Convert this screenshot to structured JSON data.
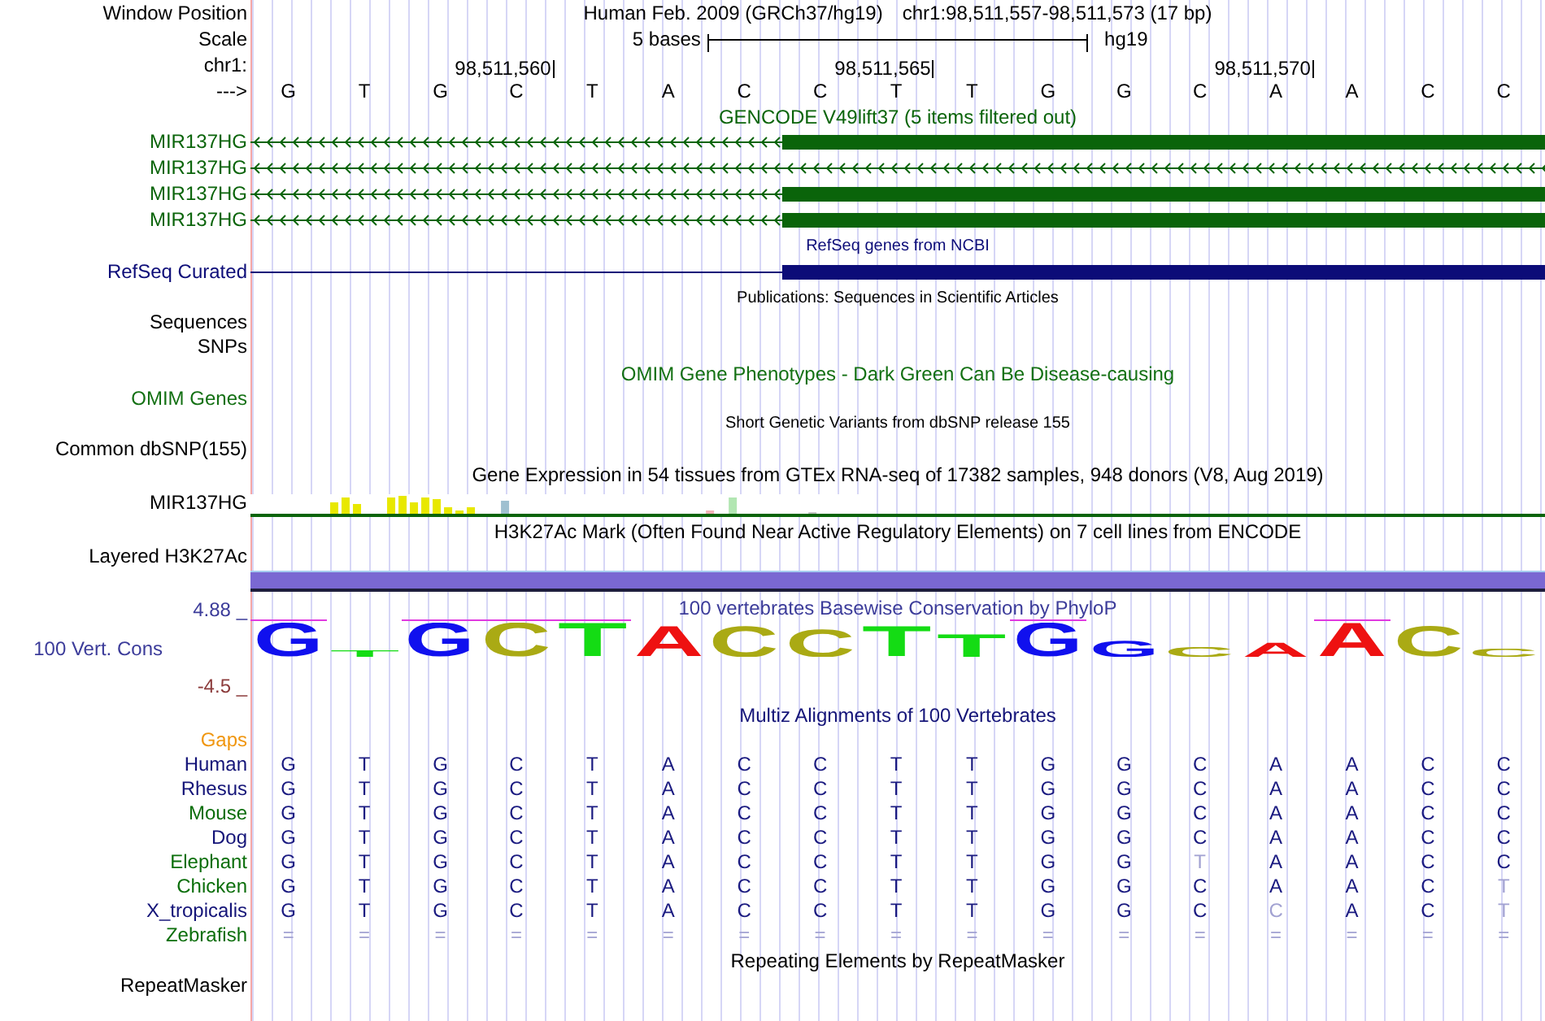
{
  "position_bar": {
    "label": "Window Position",
    "assembly": "Human Feb. 2009 (GRCh37/hg19)",
    "range": "chr1:98,511,557-98,511,573 (17 bp)"
  },
  "scale": {
    "label": "Scale",
    "length": "5 bases",
    "assembly": "hg19"
  },
  "ruler": {
    "label": "chr1:",
    "strand_label": "--->",
    "positions": [
      {
        "base": "G"
      },
      {
        "base": "T"
      },
      {
        "base": "G"
      },
      {
        "base": "C",
        "coordinate": "98,511,560"
      },
      {
        "base": "T"
      },
      {
        "base": "A"
      },
      {
        "base": "C"
      },
      {
        "base": "C"
      },
      {
        "base": "T",
        "coordinate": "98,511,565"
      },
      {
        "base": "T"
      },
      {
        "base": "G"
      },
      {
        "base": "G"
      },
      {
        "base": "C"
      },
      {
        "base": "A",
        "coordinate": "98,511,570"
      },
      {
        "base": "A"
      },
      {
        "base": "C"
      },
      {
        "base": "C"
      }
    ]
  },
  "tracks": [
    {
      "kind": "gencode",
      "title": "GENCODE V49lift37 (5 items filtered out)",
      "color": "#0a640a",
      "arrows": true,
      "items": [
        {
          "label": "MIR137HG",
          "thick": true
        },
        {
          "label": "MIR137HG",
          "thick": false
        },
        {
          "label": "MIR137HG",
          "thick": true
        },
        {
          "label": "MIR137HG",
          "thick": true
        }
      ]
    },
    {
      "kind": "refseq",
      "title": "RefSeq genes from NCBI",
      "color": "#0c0c78",
      "arrows": false,
      "items": [
        {
          "label": "RefSeq Curated",
          "thick": true
        }
      ]
    },
    {
      "kind": "publications",
      "title": "Publications: Sequences in Scientific Articles",
      "color": "#000000",
      "rows": [
        "Sequences",
        "SNPs"
      ]
    },
    {
      "kind": "omim",
      "title": "OMIM Gene Phenotypes - Dark Green Can Be Disease-causing",
      "color": "#137013",
      "rows": [
        "OMIM Genes"
      ]
    },
    {
      "kind": "dbsnp",
      "title": "Short Genetic Variants from dbSNP release 155",
      "color": "#000000",
      "rows": [
        "Common dbSNP(155)"
      ]
    },
    {
      "kind": "gtex",
      "title": "Gene Expression in 54 tissues from GTEx RNA-seq of 17382 samples, 948 donors (V8, Aug 2019)",
      "color": "#000000",
      "rows": [
        "MIR137HG"
      ]
    },
    {
      "kind": "layered",
      "title": "H3K27Ac Mark (Often Found Near Active Regulatory Elements) on 7 cell lines from ENCODE",
      "color": "#000000",
      "rows": [
        "Layered H3K27Ac"
      ]
    },
    {
      "kind": "phylop",
      "title": "100 vertebrates Basewise Conservation by PhyloP",
      "color": "#3c3c9a",
      "label": "100 Vert. Cons",
      "scale": [
        {
          "text": "4.88 _",
          "color": "#3c3c9a"
        },
        {
          "text": "-4.5 _",
          "color": "#8c3c3c"
        }
      ],
      "letters": [
        {
          "base": "G",
          "color": "#1010ee",
          "clipped": true
        },
        {
          "base": "T",
          "color": "#14dc14",
          "clipped": false
        },
        {
          "base": "G",
          "color": "#1010ee",
          "clipped": true
        },
        {
          "base": "C",
          "color": "#aaaa14",
          "clipped": true
        },
        {
          "base": "T",
          "color": "#14dc14",
          "clipped": true
        },
        {
          "base": "A",
          "color": "#ee1111",
          "clipped": false
        },
        {
          "base": "C",
          "color": "#aaaa14",
          "clipped": false
        },
        {
          "base": "C",
          "color": "#aaaa14",
          "clipped": false
        },
        {
          "base": "T",
          "color": "#14dc14",
          "clipped": false
        },
        {
          "base": "T",
          "color": "#14dc14",
          "clipped": false
        },
        {
          "base": "G",
          "color": "#1010ee",
          "clipped": true
        },
        {
          "base": "G",
          "color": "#1010ee",
          "clipped": false
        },
        {
          "base": "C",
          "color": "#aaaa14",
          "clipped": false
        },
        {
          "base": "A",
          "color": "#ee1111",
          "clipped": false
        },
        {
          "base": "A",
          "color": "#ee1111",
          "clipped": true
        },
        {
          "base": "C",
          "color": "#aaaa14",
          "clipped": false
        },
        {
          "base": "C",
          "color": "#aaaa14",
          "clipped": false
        }
      ]
    },
    {
      "kind": "multiz",
      "title": "Multiz Alignments of 100 Vertebrates",
      "color": "#141478",
      "gaps_label": "Gaps",
      "species": [
        {
          "name": "Human",
          "color": "#141478",
          "bases": [
            {
              "base": "G",
              "dimmed": false
            },
            {
              "base": "T",
              "dimmed": false
            },
            {
              "base": "G",
              "dimmed": false
            },
            {
              "base": "C",
              "dimmed": false
            },
            {
              "base": "T",
              "dimmed": false
            },
            {
              "base": "A",
              "dimmed": false
            },
            {
              "base": "C",
              "dimmed": false
            },
            {
              "base": "C",
              "dimmed": false
            },
            {
              "base": "T",
              "dimmed": false
            },
            {
              "base": "T",
              "dimmed": false
            },
            {
              "base": "G",
              "dimmed": false
            },
            {
              "base": "G",
              "dimmed": false
            },
            {
              "base": "C",
              "dimmed": false
            },
            {
              "base": "A",
              "dimmed": false
            },
            {
              "base": "A",
              "dimmed": false
            },
            {
              "base": "C",
              "dimmed": false
            },
            {
              "base": "C",
              "dimmed": false
            }
          ]
        },
        {
          "name": "Rhesus",
          "color": "#141478",
          "bases": [
            {
              "base": "G",
              "dimmed": false
            },
            {
              "base": "T",
              "dimmed": false
            },
            {
              "base": "G",
              "dimmed": false
            },
            {
              "base": "C",
              "dimmed": false
            },
            {
              "base": "T",
              "dimmed": false
            },
            {
              "base": "A",
              "dimmed": false
            },
            {
              "base": "C",
              "dimmed": false
            },
            {
              "base": "C",
              "dimmed": false
            },
            {
              "base": "T",
              "dimmed": false
            },
            {
              "base": "T",
              "dimmed": false
            },
            {
              "base": "G",
              "dimmed": false
            },
            {
              "base": "G",
              "dimmed": false
            },
            {
              "base": "C",
              "dimmed": false
            },
            {
              "base": "A",
              "dimmed": false
            },
            {
              "base": "A",
              "dimmed": false
            },
            {
              "base": "C",
              "dimmed": false
            },
            {
              "base": "C",
              "dimmed": false
            }
          ]
        },
        {
          "name": "Mouse",
          "color": "#0b6e0b",
          "bases": [
            {
              "base": "G",
              "dimmed": false
            },
            {
              "base": "T",
              "dimmed": false
            },
            {
              "base": "G",
              "dimmed": false
            },
            {
              "base": "C",
              "dimmed": false
            },
            {
              "base": "T",
              "dimmed": false
            },
            {
              "base": "A",
              "dimmed": false
            },
            {
              "base": "C",
              "dimmed": false
            },
            {
              "base": "C",
              "dimmed": false
            },
            {
              "base": "T",
              "dimmed": false
            },
            {
              "base": "T",
              "dimmed": false
            },
            {
              "base": "G",
              "dimmed": false
            },
            {
              "base": "G",
              "dimmed": false
            },
            {
              "base": "C",
              "dimmed": false
            },
            {
              "base": "A",
              "dimmed": false
            },
            {
              "base": "A",
              "dimmed": false
            },
            {
              "base": "C",
              "dimmed": false
            },
            {
              "base": "C",
              "dimmed": false
            }
          ]
        },
        {
          "name": "Dog",
          "color": "#141478",
          "bases": [
            {
              "base": "G",
              "dimmed": false
            },
            {
              "base": "T",
              "dimmed": false
            },
            {
              "base": "G",
              "dimmed": false
            },
            {
              "base": "C",
              "dimmed": false
            },
            {
              "base": "T",
              "dimmed": false
            },
            {
              "base": "A",
              "dimmed": false
            },
            {
              "base": "C",
              "dimmed": false
            },
            {
              "base": "C",
              "dimmed": false
            },
            {
              "base": "T",
              "dimmed": false
            },
            {
              "base": "T",
              "dimmed": false
            },
            {
              "base": "G",
              "dimmed": false
            },
            {
              "base": "G",
              "dimmed": false
            },
            {
              "base": "C",
              "dimmed": false
            },
            {
              "base": "A",
              "dimmed": false
            },
            {
              "base": "A",
              "dimmed": false
            },
            {
              "base": "C",
              "dimmed": false
            },
            {
              "base": "C",
              "dimmed": false
            }
          ]
        },
        {
          "name": "Elephant",
          "color": "#0b6e0b",
          "bases": [
            {
              "base": "G",
              "dimmed": false
            },
            {
              "base": "T",
              "dimmed": false
            },
            {
              "base": "G",
              "dimmed": false
            },
            {
              "base": "C",
              "dimmed": false
            },
            {
              "base": "T",
              "dimmed": false
            },
            {
              "base": "A",
              "dimmed": false
            },
            {
              "base": "C",
              "dimmed": false
            },
            {
              "base": "C",
              "dimmed": false
            },
            {
              "base": "T",
              "dimmed": false
            },
            {
              "base": "T",
              "dimmed": false
            },
            {
              "base": "G",
              "dimmed": false
            },
            {
              "base": "G",
              "dimmed": false
            },
            {
              "base": "T",
              "dimmed": true
            },
            {
              "base": "A",
              "dimmed": false
            },
            {
              "base": "A",
              "dimmed": false
            },
            {
              "base": "C",
              "dimmed": false
            },
            {
              "base": "C",
              "dimmed": false
            }
          ]
        },
        {
          "name": "Chicken",
          "color": "#0b6e0b",
          "bases": [
            {
              "base": "G",
              "dimmed": false
            },
            {
              "base": "T",
              "dimmed": false
            },
            {
              "base": "G",
              "dimmed": false
            },
            {
              "base": "C",
              "dimmed": false
            },
            {
              "base": "T",
              "dimmed": false
            },
            {
              "base": "A",
              "dimmed": false
            },
            {
              "base": "C",
              "dimmed": false
            },
            {
              "base": "C",
              "dimmed": false
            },
            {
              "base": "T",
              "dimmed": false
            },
            {
              "base": "T",
              "dimmed": false
            },
            {
              "base": "G",
              "dimmed": false
            },
            {
              "base": "G",
              "dimmed": false
            },
            {
              "base": "C",
              "dimmed": false
            },
            {
              "base": "A",
              "dimmed": false
            },
            {
              "base": "A",
              "dimmed": false
            },
            {
              "base": "C",
              "dimmed": false
            },
            {
              "base": "T",
              "dimmed": true
            }
          ]
        },
        {
          "name": "X_tropicalis",
          "color": "#141478",
          "bases": [
            {
              "base": "G",
              "dimmed": false
            },
            {
              "base": "T",
              "dimmed": false
            },
            {
              "base": "G",
              "dimmed": false
            },
            {
              "base": "C",
              "dimmed": false
            },
            {
              "base": "T",
              "dimmed": false
            },
            {
              "base": "A",
              "dimmed": false
            },
            {
              "base": "C",
              "dimmed": false
            },
            {
              "base": "C",
              "dimmed": false
            },
            {
              "base": "T",
              "dimmed": false
            },
            {
              "base": "T",
              "dimmed": false
            },
            {
              "base": "G",
              "dimmed": false
            },
            {
              "base": "G",
              "dimmed": false
            },
            {
              "base": "C",
              "dimmed": false
            },
            {
              "base": "C",
              "dimmed": true
            },
            {
              "base": "A",
              "dimmed": false
            },
            {
              "base": "C",
              "dimmed": false
            },
            {
              "base": "T",
              "dimmed": true
            }
          ]
        },
        {
          "name": "Zebrafish",
          "color": "#0b6e0b",
          "bases": [
            {
              "base": "=",
              "dimmed": true
            },
            {
              "base": "=",
              "dimmed": true
            },
            {
              "base": "=",
              "dimmed": true
            },
            {
              "base": "=",
              "dimmed": true
            },
            {
              "base": "=",
              "dimmed": true
            },
            {
              "base": "=",
              "dimmed": true
            },
            {
              "base": "=",
              "dimmed": true
            },
            {
              "base": "=",
              "dimmed": true
            },
            {
              "base": "=",
              "dimmed": true
            },
            {
              "base": "=",
              "dimmed": true
            },
            {
              "base": "=",
              "dimmed": true
            },
            {
              "base": "=",
              "dimmed": true
            },
            {
              "base": "=",
              "dimmed": true
            },
            {
              "base": "=",
              "dimmed": true
            },
            {
              "base": "=",
              "dimmed": true
            },
            {
              "base": "=",
              "dimmed": true
            },
            {
              "base": "=",
              "dimmed": true
            }
          ]
        }
      ]
    },
    {
      "kind": "repeatmasker",
      "title": "Repeating Elements by RepeatMasker",
      "color": "#000000",
      "rows": [
        "RepeatMasker"
      ]
    }
  ]
}
